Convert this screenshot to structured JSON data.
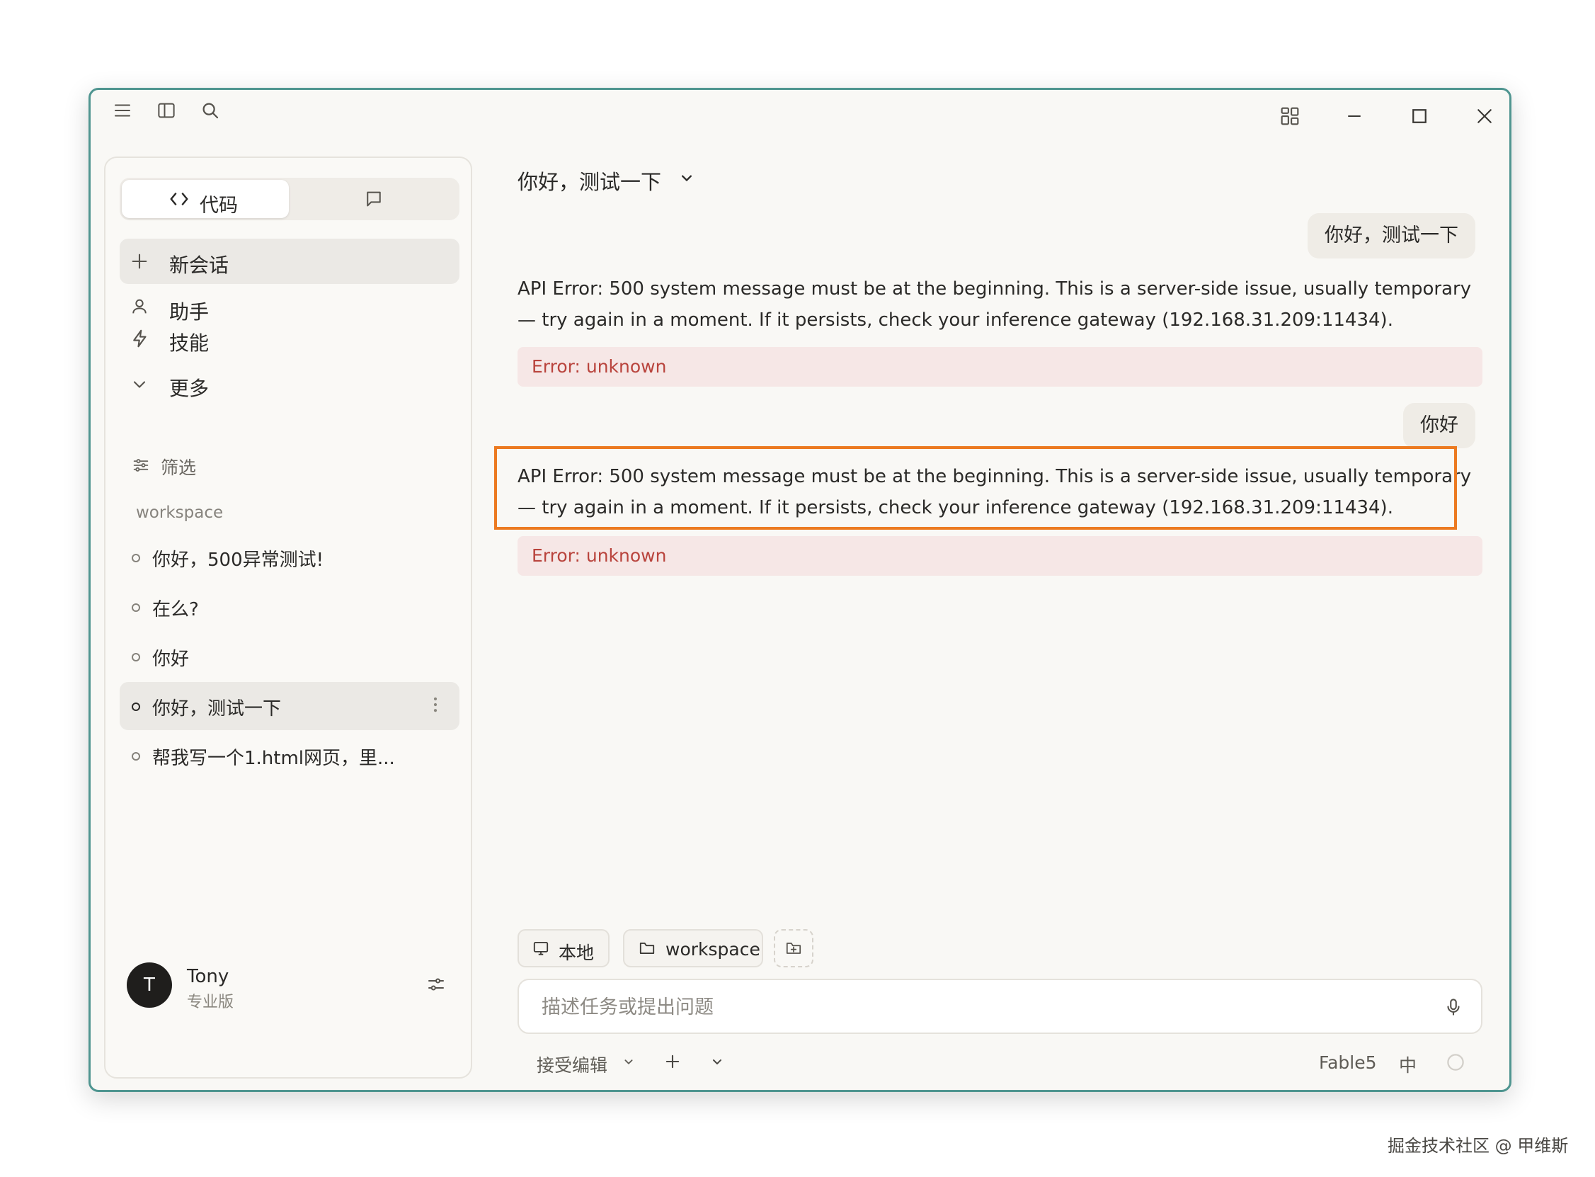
{
  "sidebar": {
    "mode_toggle": {
      "code_label": "代码",
      "chat_icon": "chat-bubble-icon"
    },
    "nav": [
      {
        "label": "新会话",
        "icon": "plus-icon"
      },
      {
        "label": "助手",
        "icon": "person-icon"
      },
      {
        "label": "技能",
        "icon": "lightning-icon"
      },
      {
        "label": "更多",
        "icon": "chevron-down-icon"
      }
    ],
    "filter_label": "筛选",
    "section_title": "workspace",
    "conversations": [
      {
        "title": "你好，500异常测试!"
      },
      {
        "title": "在么?"
      },
      {
        "title": "你好"
      },
      {
        "title": "你好，测试一下",
        "active": true
      },
      {
        "title": "帮我写一个1.html网页，里..."
      }
    ],
    "user": {
      "initial": "T",
      "name": "Tony",
      "plan": "专业版"
    }
  },
  "main": {
    "title": "你好，测试一下",
    "messages": [
      {
        "role": "user",
        "text": "你好，测试一下"
      },
      {
        "role": "assistant",
        "text": "API Error: 500 system message must be at the beginning. This is a server-side issue, usually temporary — try again in a moment. If it persists, check your inference gateway (192.168.31.209:11434).",
        "error": "Error: unknown"
      },
      {
        "role": "user",
        "text": "你好"
      },
      {
        "role": "assistant",
        "text": "API Error: 500 system message must be at the beginning. This is a server-side issue, usually temporary — try again in a moment. If it persists, check your inference gateway (192.168.31.209:11434).",
        "error": "Error: unknown",
        "highlighted": true
      }
    ],
    "chips": {
      "local": "本地",
      "folder": "workspace"
    },
    "input": {
      "placeholder": "描述任务或提出问题",
      "value": ""
    },
    "footer": {
      "mode": "接受编辑",
      "model": "Fable5",
      "lang": "中"
    }
  },
  "watermark": "掘金技术社区 @ 甲维斯",
  "colors": {
    "accent_border": "#4f9590",
    "highlight": "#ec7a21",
    "error_text": "#b9443d",
    "error_bg": "#f6e7e6"
  }
}
